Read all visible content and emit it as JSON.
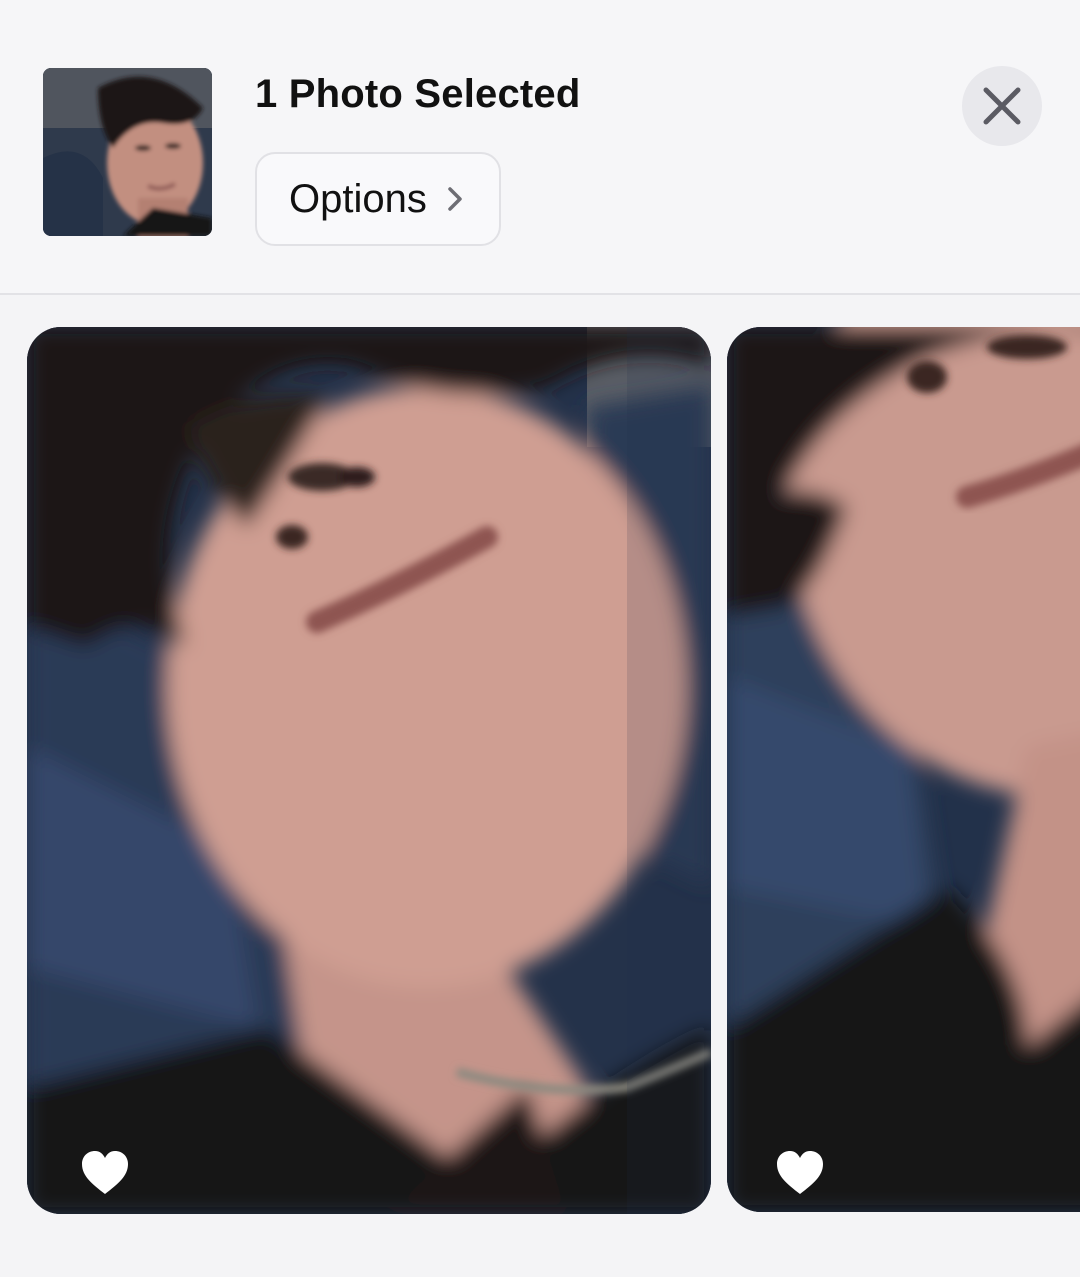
{
  "header": {
    "title": "1 Photo Selected",
    "options_label": "Options",
    "close_icon": "close-icon",
    "chevron_icon": "chevron-right-icon"
  },
  "photos": {
    "thumbnail": "selected-photo-thumbnail",
    "items": [
      {
        "favorite_icon": "heart-icon",
        "favorited": true
      },
      {
        "favorite_icon": "heart-icon",
        "favorited": true
      }
    ]
  },
  "colors": {
    "background": "#f4f4f6",
    "text": "#111111",
    "close_button_bg": "#e8e8ec",
    "heart": "#ffffff"
  }
}
